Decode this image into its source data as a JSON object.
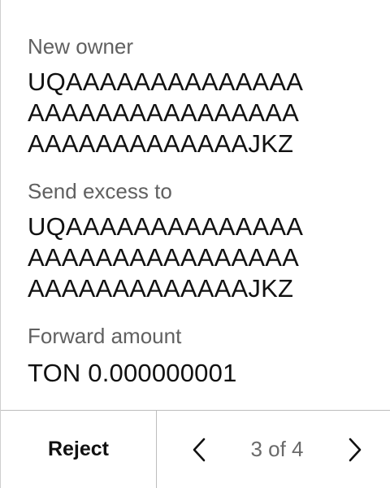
{
  "fields": {
    "new_owner": {
      "label": "New owner",
      "lines": [
        "UQAAAAAAAAAAAAAA",
        "AAAAAAAAAAAAAAAA",
        "AAAAAAAAAAAAAJKZ"
      ]
    },
    "send_excess_to": {
      "label": "Send excess to",
      "lines": [
        "UQAAAAAAAAAAAAAA",
        "AAAAAAAAAAAAAAAA",
        "AAAAAAAAAAAAAJKZ"
      ]
    },
    "forward_amount": {
      "label": "Forward amount",
      "value": "TON 0.000000001"
    }
  },
  "footer": {
    "reject_label": "Reject",
    "page_indicator": "3 of 4",
    "prev_icon": "chevron-left-icon",
    "next_icon": "chevron-right-icon"
  }
}
